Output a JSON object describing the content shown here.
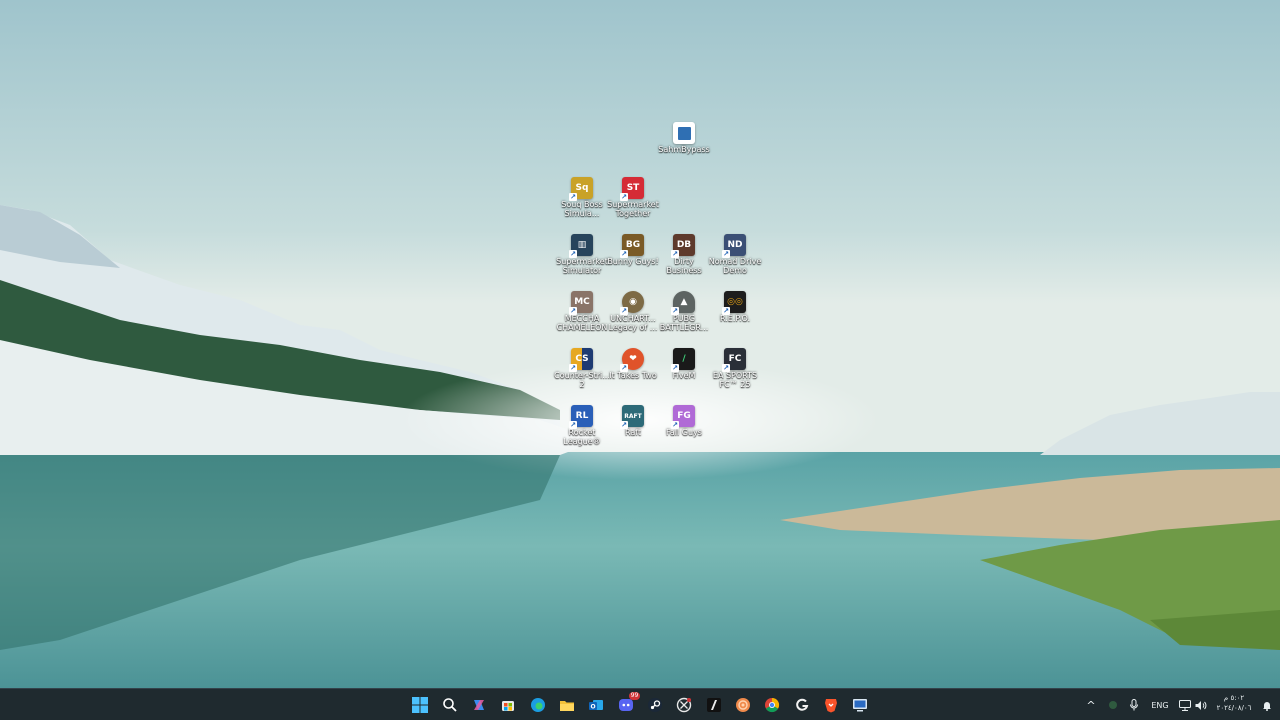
{
  "desktop": {
    "icons": [
      {
        "label": "SahmBypass",
        "icon": "app-window-icon",
        "color": "#2f6fb3"
      },
      {
        "label": "Souq Boss Simula...",
        "icon": "souq-boss-game-icon",
        "color": "#c9a227"
      },
      {
        "label": "Supermarket Together",
        "icon": "supermarket-together-icon",
        "color": "#d52b36",
        "text": "ST"
      },
      {
        "label": "Supermarket Simulator",
        "icon": "supermarket-simulator-icon",
        "color": "#27445c"
      },
      {
        "label": "Bunny Guys!",
        "icon": "bunny-guys-icon",
        "color": "#7a5a26"
      },
      {
        "label": "Dirty Business",
        "icon": "dirty-business-icon",
        "color": "#5e3a2c"
      },
      {
        "label": "Nomad Drive Demo",
        "icon": "nomad-drive-icon",
        "color": "#3b4f75"
      },
      {
        "label": "MECCHA CHAMELEON",
        "icon": "meccha-chameleon-icon",
        "color": "#8a7468"
      },
      {
        "label": "UNCHART... Legacy of ...",
        "icon": "uncharted-icon",
        "color": "#7d6a45"
      },
      {
        "label": "PUBG BATTLEGR...",
        "icon": "pubg-helmet-icon",
        "color": "#5d6462"
      },
      {
        "label": "R.E.P.O.",
        "icon": "repo-icon",
        "color": "#e6a417"
      },
      {
        "label": "Counter-Stri... 2",
        "icon": "counter-strike-icon",
        "color": "#1e3b73"
      },
      {
        "label": "It Takes Two",
        "icon": "it-takes-two-icon",
        "color": "#e0532a"
      },
      {
        "label": "FiveM",
        "icon": "fivem-icon",
        "color": "#1a1a1a",
        "text": "/"
      },
      {
        "label": "EA SPORTS FC™ 25",
        "icon": "ea-sports-fc-icon",
        "color": "#2a2f38"
      },
      {
        "label": "Rocket League®",
        "icon": "rocket-league-icon",
        "color": "#2a5fb8"
      },
      {
        "label": "Raft",
        "icon": "raft-icon",
        "color": "#2d6a78",
        "text": "RAFT"
      },
      {
        "label": "Fall Guys",
        "icon": "fall-guys-icon",
        "color": "#b06ad6"
      }
    ]
  },
  "taskbar": {
    "apps": [
      {
        "icon": "windows-start-icon"
      },
      {
        "icon": "search-icon"
      },
      {
        "icon": "copilot-icon"
      },
      {
        "icon": "microsoft-store-icon"
      },
      {
        "icon": "edge-browser-icon"
      },
      {
        "icon": "file-explorer-icon"
      },
      {
        "icon": "outlook-icon"
      },
      {
        "icon": "discord-icon",
        "badge": "99"
      },
      {
        "icon": "steam-icon"
      },
      {
        "icon": "xbox-icon"
      },
      {
        "icon": "fivem-taskbar-icon"
      },
      {
        "icon": "orange-swirl-app-icon"
      },
      {
        "icon": "chrome-icon"
      },
      {
        "icon": "logitech-g-hub-icon"
      },
      {
        "icon": "brave-browser-icon"
      },
      {
        "icon": "remote-desktop-icon"
      }
    ],
    "tray": {
      "chevron": "^",
      "language": "ENG",
      "time": "٥:٠٢ م",
      "date": "٢٠٢٤/٠٨/٠٦"
    }
  }
}
